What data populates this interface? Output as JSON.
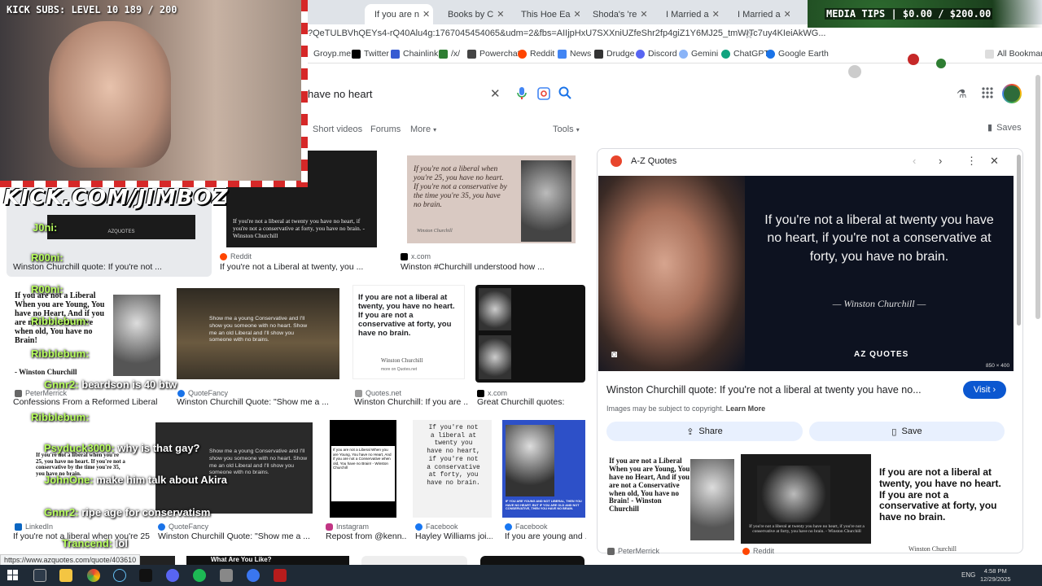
{
  "tabs": [
    {
      "label": "If you are n",
      "active": true
    },
    {
      "label": "Books by C"
    },
    {
      "label": "This Hoe Ea"
    },
    {
      "label": "Shoda's 're"
    },
    {
      "label": "I Married a"
    },
    {
      "label": "I Married a"
    }
  ],
  "url": "?QeTULBVhQEYs4-rQ40Alu4g:1767045454065&udm=2&fbs=AIIjpHxU7SXXniUZfeShr2fp4giZ1Y6MJ25_tmWITc7uy4KIeiAkWG...",
  "bookmarks": [
    "Groyp.me",
    "Twitter",
    "Chainlink",
    "/x/",
    "Powerchat",
    "Reddit",
    "News",
    "Drudge",
    "Discord",
    "Gemini",
    "ChatGPT",
    "Google Earth",
    "All Bookmarks"
  ],
  "search": {
    "query": "have no heart"
  },
  "nav": {
    "short_videos": "Short videos",
    "forums": "Forums",
    "more": "More",
    "tools": "Tools",
    "saves": "Saves"
  },
  "results": [
    {
      "src": "",
      "title": "Winston Churchill quote: If you're not ..."
    },
    {
      "src": "Reddit",
      "title": "If you're not a Liberal at twenty, you ..."
    },
    {
      "src": "x.com",
      "title": "Winston #Churchill understood how ..."
    },
    {
      "src": "PeterMerrick",
      "title": "Confessions From a Reformed Liberal"
    },
    {
      "src": "QuoteFancy",
      "title": "Winston Churchill Quote: \"Show me a ..."
    },
    {
      "src": "Quotes.net",
      "title": "Winston Churchill: If you are ..."
    },
    {
      "src": "x.com",
      "title": "Great Churchill quotes:"
    },
    {
      "src": "LinkedIn",
      "title": "If you're not a liberal when you're 25 ..."
    },
    {
      "src": "QuoteFancy",
      "title": "Winston Churchill Quote: \"Show me a ..."
    },
    {
      "src": "Instagram",
      "title": "Repost from @kenn..."
    },
    {
      "src": "Facebook",
      "title": "Hayley Williams joi..."
    },
    {
      "src": "Facebook",
      "title": "If you are young and ..."
    }
  ],
  "thumb_texts": {
    "r1": "If you're not a liberal when you're 25, you have no heart. If you're not a conservative by the time you're 35, you have no brain.",
    "r1_sig": "Winston Churchill",
    "r2": "If you're not a liberal at twenty you have no heart, if you're not a conservative at forty, you have no brain. - Winston Churchill",
    "q_young": "If you are not a Liberal When you are Young, You have no Heart, And if you are not a Conservative when old, You have no Brain! - Winston Churchill",
    "q_young_short": "If you are not a Liberal When you are Young, You have no Heart, And if you are not a Conservative when old, You have no Brain!",
    "q_signed": "- Winston Churchill",
    "show_me": "Show me a young Conservative and I'll show you someone with no heart. Show me an old Liberal and I'll show you someone with no brains.",
    "qnet": "If you are not a liberal at twenty, you have no heart. If you are not a conservative at forty, you have no brain.",
    "qnet_sig": "Winston Churchill",
    "qnet_more": "more on Quotes.net",
    "typewriter": "If you're not a liberal at twenty you have no heart, if you're not a conservative at forty, you have no brain.",
    "azq": "AZQUOTES",
    "young_old_fb": "IF YOU ARE YOUNG AND NOT LIBERAL, THEN YOU HAVE NO HEART. BUT IF YOU ARE OLD AND NOT CONSERVATIVE, THEN YOU HAVE NO BRAIN.",
    "what_are_you_like": "What Are You Like?"
  },
  "panel": {
    "source": "A-Z Quotes",
    "quote": "If you're not a liberal at twenty you have no heart, if you're not a conservative at forty, you have no brain.",
    "author": "Winston Churchill",
    "brand": "AZ QUOTES",
    "size": "850 × 400",
    "title": "Winston Churchill quote: If you're not a liberal at twenty you have no...",
    "visit": "Visit",
    "copyright": "Images may be subject to copyright.",
    "learn_more": "Learn More",
    "share": "Share",
    "save": "Save",
    "related": [
      {
        "src": "PeterMerrick",
        "text": "If you are not a Liberal When you are Young, You have no Heart, And if you are not a Conservative when old, You have no Brain! - Winston Churchill"
      },
      {
        "src": "Reddit",
        "text": "If you're not a liberal at twenty you have no heart, if you're not a conservative at forty, you have no brain. - Winston Churchill"
      },
      {
        "src": "",
        "text": "If you are not a liberal at twenty, you have no heart. If you are not a conservative at forty, you have no brain."
      }
    ],
    "related_sig": "Winston Churchill"
  },
  "overlay": {
    "kick_subs": "KICK SUBS: LEVEL 10 189 / 200",
    "media_tips": "MEDIA TIPS | $0.00 / $200.00",
    "kick_url": "KICK.COM/JIMBOZ",
    "chat": [
      {
        "user": "J0ni:",
        "msg": ""
      },
      {
        "user": "R00ni:",
        "msg": ""
      },
      {
        "user": "R00ni:",
        "msg": ""
      },
      {
        "user": "Ribblebum:",
        "msg": ""
      },
      {
        "user": "Ribblebum:",
        "msg": ""
      },
      {
        "user": "Gnnr2:",
        "msg": "beardson is 40 btw"
      },
      {
        "user": "Ribblebum:",
        "msg": ""
      },
      {
        "user": "Psyduck3000:",
        "msg": "why is that gay?"
      },
      {
        "user": "JohnOne:",
        "msg": "make him talk about Akira"
      },
      {
        "user": "Gnnr2:",
        "msg": "ripe age for conservatism"
      },
      {
        "user": "Trancend:",
        "msg": "lol"
      }
    ]
  },
  "status_url": "https://www.azquotes.com/quote/403610",
  "tray": {
    "lang": "ENG",
    "time": "4:58 PM",
    "date": "12/29/2025"
  }
}
